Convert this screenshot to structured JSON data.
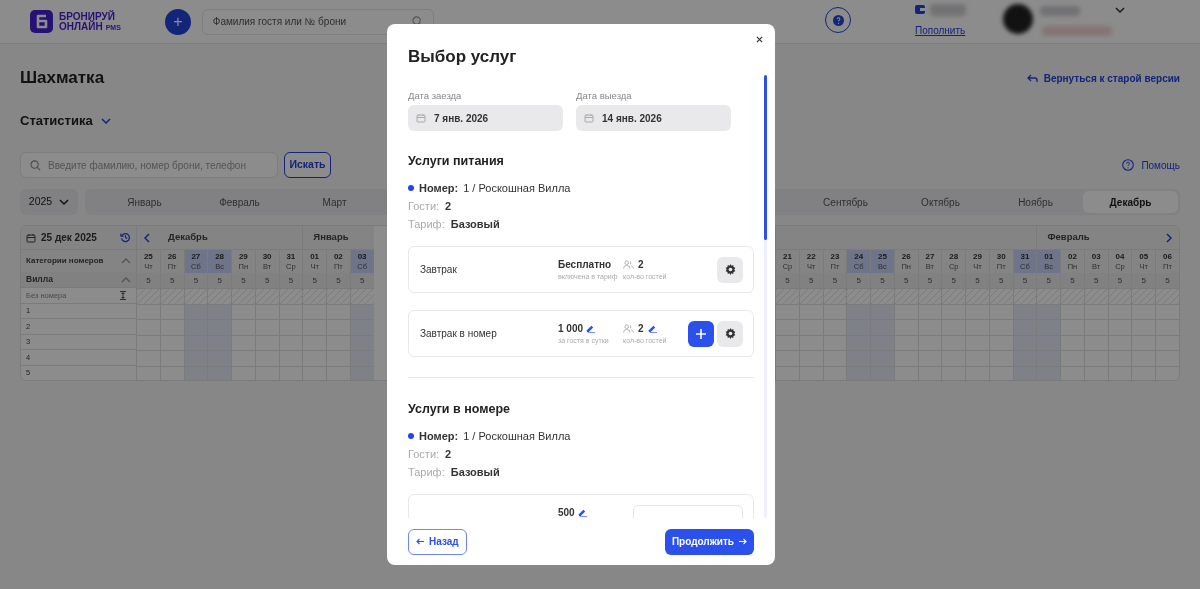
{
  "header": {
    "logo": {
      "line1": "БРОНИРУЙ",
      "line2": "ОНЛАЙН",
      "tag": "PMS"
    },
    "add_symbol": "+",
    "search_placeholder": "Фамилия гостя или № брони",
    "top_up_link": "Пополнить"
  },
  "page": {
    "title": "Шахматка",
    "back_link": "Вернуться к старой версии",
    "stats": "Статистика",
    "search_placeholder": "Введите фамилию, номер брони, телефон",
    "search_button": "Искать",
    "help": "Помощь",
    "year": "2025",
    "months_left": [
      {
        "label": "Январь",
        "selected": false
      },
      {
        "label": "Февраль",
        "selected": false
      },
      {
        "label": "Март",
        "selected": false
      }
    ],
    "months_right": [
      {
        "label": "Сентябрь",
        "selected": false
      },
      {
        "label": "Октябрь",
        "selected": false
      },
      {
        "label": "Ноябрь",
        "selected": false
      },
      {
        "label": "Декабрь",
        "selected": true
      }
    ]
  },
  "calendar": {
    "date": "25 дек 2025",
    "categories_header": "Категории номеров",
    "category": "Вилла",
    "rows": [
      "Без номера",
      "1",
      "2",
      "3",
      "4",
      "5"
    ],
    "days_left": [
      {
        "num": "25",
        "wd": "Чт",
        "weekend": false,
        "avail": "5",
        "month": "Декабрь"
      },
      {
        "num": "26",
        "wd": "Пт",
        "weekend": false,
        "avail": "5"
      },
      {
        "num": "27",
        "wd": "Сб",
        "weekend": true,
        "avail": "5"
      },
      {
        "num": "28",
        "wd": "Вс",
        "weekend": true,
        "avail": "5"
      },
      {
        "num": "29",
        "wd": "Пн",
        "weekend": false,
        "avail": "5"
      },
      {
        "num": "30",
        "wd": "Вт",
        "weekend": false,
        "avail": "5"
      },
      {
        "num": "31",
        "wd": "Ср",
        "weekend": false,
        "avail": "5"
      },
      {
        "num": "01",
        "wd": "Чт",
        "weekend": false,
        "avail": "5",
        "month": "Январь"
      },
      {
        "num": "02",
        "wd": "Пт",
        "weekend": false,
        "avail": "5"
      },
      {
        "num": "03",
        "wd": "Сб",
        "weekend": true,
        "avail": "5"
      }
    ],
    "days_right": [
      {
        "num": "21",
        "wd": "Ср",
        "weekend": false,
        "avail": "5"
      },
      {
        "num": "22",
        "wd": "Чт",
        "weekend": false,
        "avail": "5"
      },
      {
        "num": "23",
        "wd": "Пт",
        "weekend": false,
        "avail": "5"
      },
      {
        "num": "24",
        "wd": "Сб",
        "weekend": true,
        "avail": "5"
      },
      {
        "num": "25",
        "wd": "Вс",
        "weekend": true,
        "avail": "5"
      },
      {
        "num": "26",
        "wd": "Пн",
        "weekend": false,
        "avail": "5"
      },
      {
        "num": "27",
        "wd": "Вт",
        "weekend": false,
        "avail": "5"
      },
      {
        "num": "28",
        "wd": "Ср",
        "weekend": false,
        "avail": "5"
      },
      {
        "num": "29",
        "wd": "Чт",
        "weekend": false,
        "avail": "5"
      },
      {
        "num": "30",
        "wd": "Пт",
        "weekend": false,
        "avail": "5"
      },
      {
        "num": "31",
        "wd": "Сб",
        "weekend": true,
        "avail": "5"
      },
      {
        "num": "01",
        "wd": "Вс",
        "weekend": true,
        "avail": "5",
        "month": "Февраль"
      },
      {
        "num": "02",
        "wd": "Пн",
        "weekend": false,
        "avail": "5"
      },
      {
        "num": "03",
        "wd": "Вт",
        "weekend": false,
        "avail": "5"
      },
      {
        "num": "04",
        "wd": "Ср",
        "weekend": false,
        "avail": "5"
      },
      {
        "num": "05",
        "wd": "Чт",
        "weekend": false,
        "avail": "5"
      },
      {
        "num": "06",
        "wd": "Пт",
        "weekend": false,
        "avail": "5"
      }
    ]
  },
  "modal": {
    "title": "Выбор услуг",
    "dates": [
      {
        "label": "Дата заезда",
        "value": "7 янв. 2026"
      },
      {
        "label": "Дата выезда",
        "value": "14 янв. 2026"
      }
    ],
    "sections": [
      {
        "title": "Услуги питания",
        "room_label": "Номер:",
        "room": "1 / Роскошная Вилла",
        "guests_label": "Гости:",
        "guests": "2",
        "tariff_label": "Тариф:",
        "tariff": "Базовый",
        "services": [
          {
            "kind": "standard",
            "name": "Завтрак",
            "price": "Бесплатно",
            "price_note": "включена в тариф",
            "price_editable": false,
            "guests": "2",
            "guests_note": "кол-во гостей",
            "guests_editable": false,
            "can_add": false
          },
          {
            "kind": "standard",
            "name": "Завтрак в номер",
            "price": "1 000",
            "price_note": "за гостя в сутки",
            "price_editable": true,
            "guests": "2",
            "guests_note": "кол-во гостей",
            "guests_editable": true,
            "can_add": true
          }
        ]
      },
      {
        "title": "Услуги в номере",
        "room_label": "Номер:",
        "room": "1 / Роскошная Вилла",
        "guests_label": "Гости:",
        "guests": "2",
        "tariff_label": "Тариф:",
        "tariff": "Базовый",
        "services": [
          {
            "kind": "select",
            "price": "500",
            "price_editable": true
          }
        ]
      }
    ],
    "back_button": "Назад",
    "next_button": "Продолжить"
  }
}
